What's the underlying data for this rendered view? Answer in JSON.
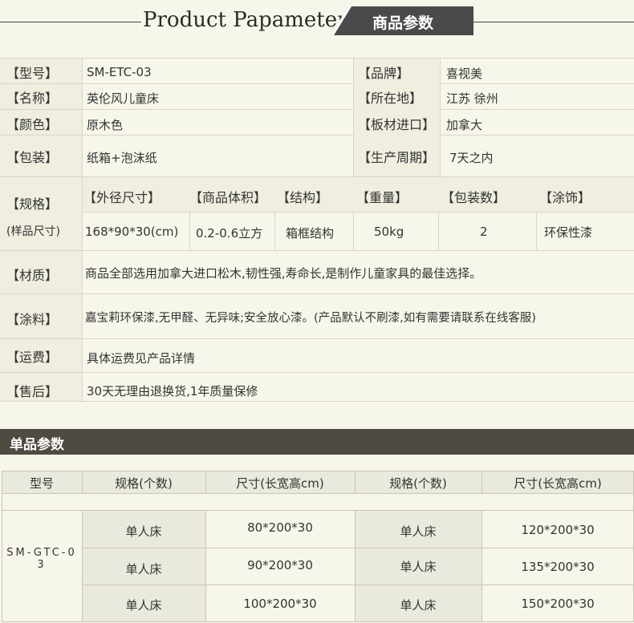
{
  "header": {
    "title_en": "Product Papameter",
    "title_cn": "商品参数"
  },
  "params": {
    "model_label": "【型号】",
    "model_value": "SM-ETC-03",
    "brand_label": "【品牌】",
    "brand_value": "喜视美",
    "name_label": "【名称】",
    "name_value": "英伦风儿童床",
    "location_label": "【所在地】",
    "location_value": "江苏 徐州",
    "color_label": "【颜色】",
    "color_value": "原木色",
    "import_label": "【板材进口】",
    "import_value": "加拿大",
    "package_label": "【包装】",
    "package_value": "纸箱+泡沫纸",
    "cycle_label": "【生产周期】",
    "cycle_value": "7天之内",
    "spec_label": "【规格】",
    "spec_sub": "(样品尺寸)",
    "spec_headers": [
      "【外径尺寸】",
      "【商品体积】",
      "【结构】",
      "【重量】",
      "【包装数】",
      "【涂饰】"
    ],
    "spec_values": [
      "168*90*30(cm)",
      "0.2-0.6立方",
      "箱框结构",
      "50kg",
      "2",
      "环保性漆"
    ],
    "material_label": "【材质】",
    "material_value": "商品全部选用加拿大进口松木,韧性强,寿命长,是制作儿童家具的最佳选择。",
    "paint_label": "【涂料】",
    "paint_value": "嘉宝莉环保漆,无甲醛、无异味;安全放心漆。(产品默认不刷漆,如有需要请联系在线客服)",
    "shipping_label": "【运费】",
    "shipping_value": "具体运费见产品详情",
    "aftersale_label": "【售后】",
    "aftersale_value": "30天无理由退换货,1年质量保修"
  },
  "single": {
    "title": "单品参数",
    "headers": [
      "型号",
      "规格(个数)",
      "尺寸(长宽高cm)",
      "规格(个数)",
      "尺寸(长宽高cm)"
    ],
    "model": "SM-GTC-03",
    "rows": [
      [
        "单人床",
        "80*200*30",
        "单人床",
        "120*200*30"
      ],
      [
        "单人床",
        "90*200*30",
        "单人床",
        "135*200*30"
      ],
      [
        "单人床",
        "100*200*30",
        "单人床",
        "150*200*30"
      ]
    ]
  }
}
